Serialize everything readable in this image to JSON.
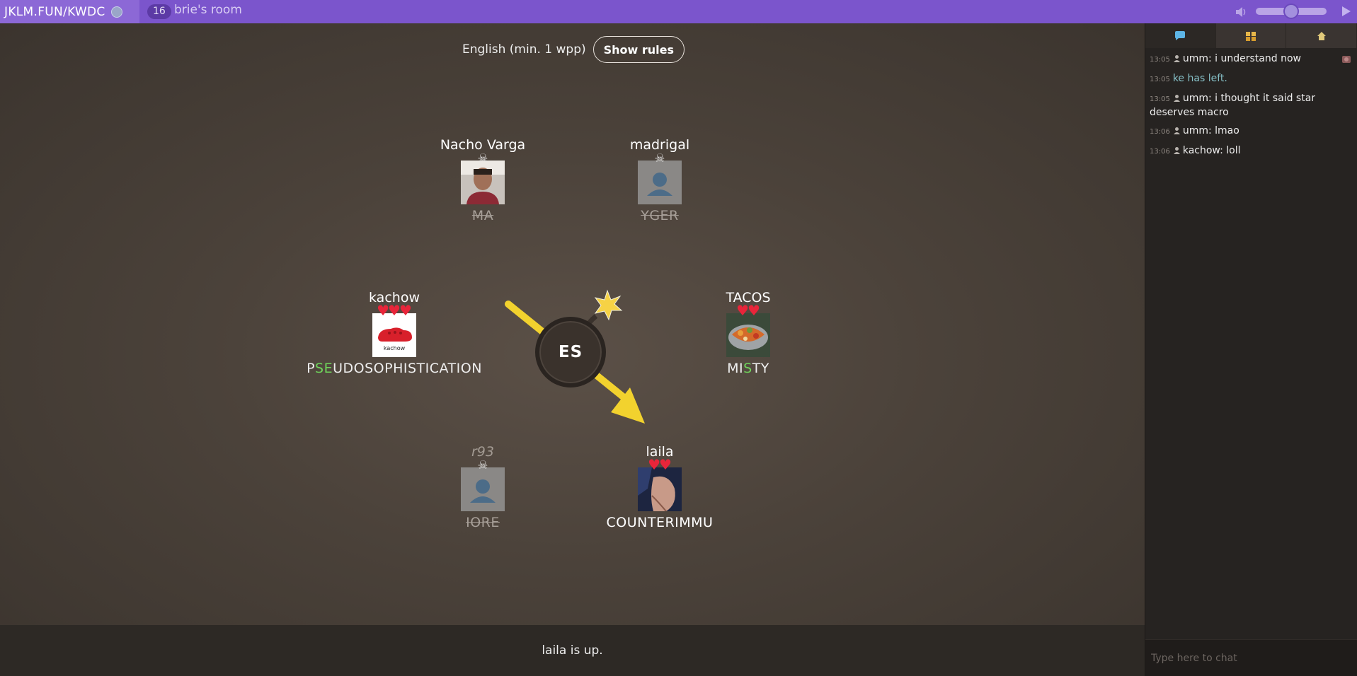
{
  "topbar": {
    "room_code": "JKLM.FUN/KWDC",
    "player_count": "16",
    "room_name": "brie's room",
    "icons": [
      "globe-icon",
      "volume-icon",
      "play-icon"
    ]
  },
  "game": {
    "language_label": "English (min. 1 wpp)",
    "show_rules_label": "Show rules",
    "syllable": "ES",
    "players": [
      {
        "name": "Nacho Varga",
        "word": "MA",
        "status": "dead"
      },
      {
        "name": "madrigal",
        "word": "YGER",
        "status": "dead"
      },
      {
        "name": "kachow",
        "word_pre": "P",
        "word_hl": "SE",
        "word_post": "UDOSOPHISTICATION",
        "lives": 3,
        "avatar_caption": "kachow"
      },
      {
        "name": "TACOS",
        "word_pre": "MI",
        "word_hl": "S",
        "word_post": "TY",
        "lives": 2
      },
      {
        "name": "r93",
        "word": "IORE",
        "status": "dead"
      },
      {
        "name": "laila",
        "word": "COUNTERIMMU",
        "lives": 2,
        "status": "active"
      }
    ]
  },
  "status_text": "laila is up.",
  "sidebar": {
    "tabs": [
      "chat-tab",
      "players-tab",
      "home-tab"
    ],
    "chat": [
      {
        "time": "13:05",
        "user": "umm",
        "text": "i understand now"
      },
      {
        "time": "13:05",
        "system": "ke has left."
      },
      {
        "time": "13:05",
        "user": "umm",
        "text": "i thought it said star deserves macro"
      },
      {
        "time": "13:06",
        "user": "umm",
        "text": "lmao"
      },
      {
        "time": "13:06",
        "user": "kachow",
        "text": "loll"
      }
    ],
    "chat_placeholder": "Type here to chat"
  },
  "colors": {
    "topbar": "#7b55cc",
    "highlight": "#6fd35b",
    "heart": "#e8253a",
    "arrow": "#f2d22e"
  }
}
